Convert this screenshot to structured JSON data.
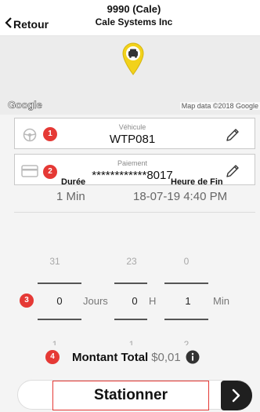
{
  "header": {
    "back_label": "Retour",
    "title": "9990 (Cale)",
    "subtitle": "Cale Systems Inc"
  },
  "map": {
    "google_logo": "Google",
    "attribution": "Map data ©2018 Google",
    "pin_color": "#f2d21b"
  },
  "vehicle": {
    "label": "Véhicule",
    "value": "WTP081",
    "icon": "steering-wheel-icon",
    "edit_icon": "pencil-icon"
  },
  "payment": {
    "label": "Paiement",
    "value": "************8017",
    "icon": "credit-card-icon",
    "edit_icon": "pencil-icon"
  },
  "duration": {
    "label": "Durée",
    "value": "1 Min"
  },
  "end_time": {
    "label": "Heure de Fin",
    "value": "18-07-19 4:40 PM"
  },
  "picker": {
    "days": {
      "prev": "31",
      "value": "0",
      "next": "1",
      "unit": "Jours"
    },
    "hours": {
      "prev": "23",
      "value": "0",
      "next": "1",
      "unit": "H"
    },
    "minutes": {
      "prev": "0",
      "value": "1",
      "next": "2",
      "unit": "Min"
    }
  },
  "total": {
    "label": "Montant Total",
    "amount": "$0,01"
  },
  "action": {
    "button_label": "Stationner"
  },
  "annotations": [
    "1",
    "2",
    "3",
    "4"
  ],
  "colors": {
    "badge": "#e53935",
    "button_border": "#e53935",
    "arrow_button": "#1f1f1f",
    "form_background": "#f4f4f4"
  }
}
